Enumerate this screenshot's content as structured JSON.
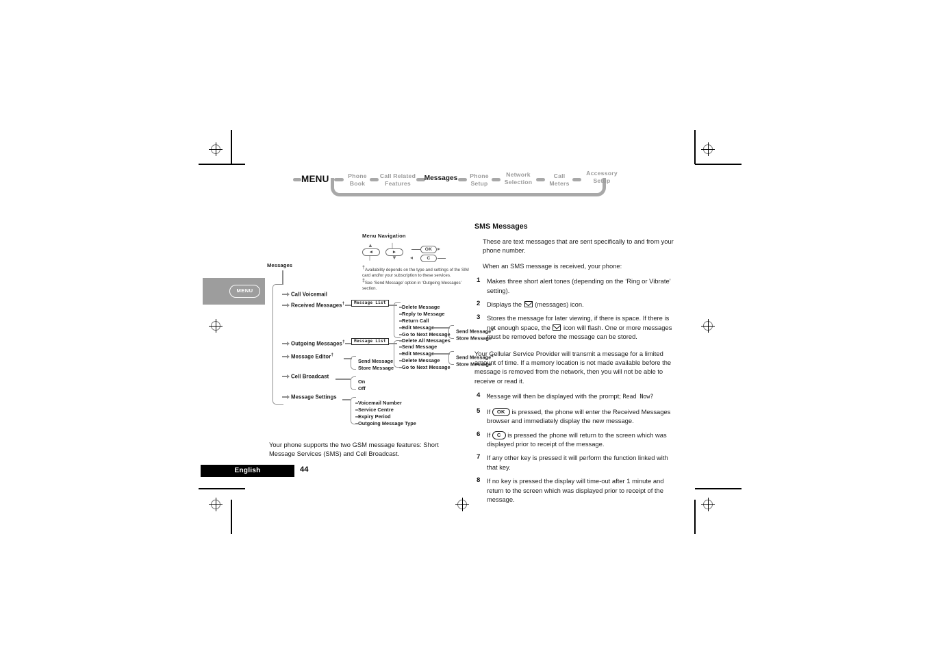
{
  "menu_flow": {
    "menu_label": "MENU",
    "items": [
      {
        "lines": [
          "Phone",
          "Book"
        ],
        "active": false
      },
      {
        "lines": [
          "Call Related",
          "Features"
        ],
        "active": false
      },
      {
        "lines": [
          "Messages"
        ],
        "active": true
      },
      {
        "lines": [
          "Phone",
          "Setup"
        ],
        "active": false
      },
      {
        "lines": [
          "Network",
          "Selection"
        ],
        "active": false
      },
      {
        "lines": [
          "Call",
          "Meters"
        ],
        "active": false
      },
      {
        "lines": [
          "Accessory",
          "Setup"
        ],
        "active": false
      }
    ]
  },
  "nav_legend": {
    "title": "Menu Navigation",
    "key_left": "◄",
    "key_right": "►",
    "key_ok": "OK",
    "key_c": "C",
    "footnotes": [
      {
        "mark": "†",
        "text": "Availability depends on the type and settings of the SIM card and/or your subscription to these services."
      },
      {
        "mark": "‡",
        "text": "See ‘Send Message’ option in ‘Outgoing Messages’ section."
      }
    ]
  },
  "menu_button": {
    "label": "MENU"
  },
  "tree": {
    "root": "Messages",
    "nodes": [
      {
        "label": "Call Voicemail",
        "dagger": ""
      },
      {
        "label": "Received Messages",
        "dagger": "†"
      },
      {
        "label": "Outgoing Messages",
        "dagger": "†"
      },
      {
        "label": "Message Editor",
        "dagger": "†"
      },
      {
        "label": "Cell Broadcast",
        "dagger": ""
      },
      {
        "label": "Message Settings",
        "dagger": ""
      }
    ],
    "lcd_box_label": "Message List",
    "received_options": [
      "Delete Message",
      "Reply to Message",
      "Return Call",
      "Edit Message",
      "Go to Next Message",
      "Delete All Messages"
    ],
    "received_sub": [
      {
        "label": "Send Message",
        "dagger": "‡"
      },
      {
        "label": "Store Message",
        "dagger": ""
      }
    ],
    "outgoing_options": [
      "Send Message",
      "Edit Message",
      "Delete Message",
      "Go to Next Message"
    ],
    "outgoing_sub": [
      {
        "label": "Send Message",
        "dagger": "‡"
      },
      {
        "label": "Store Message",
        "dagger": ""
      }
    ],
    "editor_options": [
      "Send Message",
      "Store Message"
    ],
    "broadcast_options": [
      "On",
      "Off"
    ],
    "settings_options": [
      "Voicemail Number",
      "Service Centre",
      "Expiry Period",
      "Outgoing Message Type"
    ]
  },
  "caption": "Your phone supports the two GSM message features: Short Message Services (SMS) and Cell Broadcast.",
  "footer": {
    "language": "English",
    "page_number": "44"
  },
  "right_column": {
    "heading": "SMS Messages",
    "intro1": "These are text messages that are sent specifically to and from your phone number.",
    "intro2": "When an SMS message is received, your phone:",
    "steps_part1": [
      {
        "num": "1",
        "text": "Makes three short alert tones (depending on the ‘Ring or Vibrate’ setting)."
      },
      {
        "num": "2",
        "text_before": "Displays the ",
        "icon": "envelope-icon",
        "text_after": " (messages) icon."
      },
      {
        "num": "3",
        "text_before": "Stores the message for later viewing, if there is space. If there is not enough space, the ",
        "icon": "envelope-icon",
        "text_after": " icon will flash. One or more messages must be removed before the message can be stored."
      }
    ],
    "mid_para": "Your Cellular Service Provider will transmit a message for a limited amount of time. If a memory location is not made available before the message is removed from the network, then you will not be able to receive or read it.",
    "steps_part2": [
      {
        "num": "4",
        "lcd1": "Message",
        "mid": " will then be displayed with the prompt; ",
        "lcd2": "Read Now?"
      },
      {
        "num": "5",
        "key": "OK",
        "text_before": "If ",
        "text_after": " is pressed, the phone will enter the Received Messages browser and immediately display the new message."
      },
      {
        "num": "6",
        "key": "C",
        "text_before": "If ",
        "text_after": " is pressed the phone will return to the screen which was displayed prior to receipt of the message."
      },
      {
        "num": "7",
        "text": "If any other key is pressed it will perform the function linked with that key."
      },
      {
        "num": "8",
        "text": "If no key is pressed the display will time-out after 1 minute and return to the screen which was displayed prior to receipt of the message."
      }
    ]
  },
  "colors": {
    "flow_grey": "#a8a8a8",
    "tree_grey": "#8d8d8d",
    "menu_box_grey": "#9d9d9d",
    "footer_black": "#000000",
    "text": "#1b1b1b"
  }
}
